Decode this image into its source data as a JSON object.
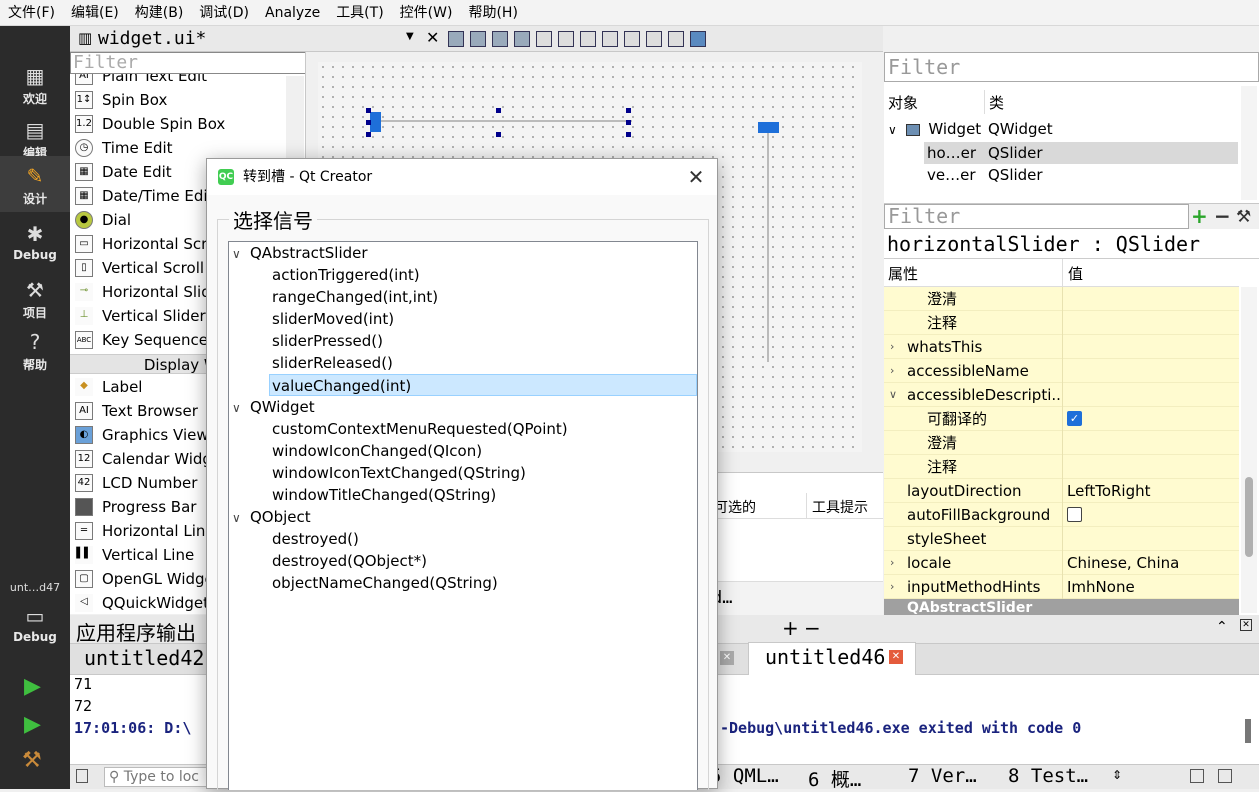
{
  "menubar": {
    "items": [
      "文件(F)",
      "编辑(E)",
      "构建(B)",
      "调试(D)",
      "Analyze",
      "工具(T)",
      "控件(W)",
      "帮助(H)"
    ]
  },
  "modes": [
    {
      "label": "欢迎",
      "icon": "grid-icon"
    },
    {
      "label": "编辑",
      "icon": "document-icon"
    },
    {
      "label": "设计",
      "icon": "pencil-icon"
    },
    {
      "label": "Debug",
      "icon": "bug-icon"
    },
    {
      "label": "项目",
      "icon": "wrench-icon"
    },
    {
      "label": "帮助",
      "icon": "help-icon"
    }
  ],
  "kit": {
    "label": "unt…d47",
    "mode": "Debug"
  },
  "editor": {
    "title": "widget.ui*"
  },
  "widgetbox": {
    "filter_placeholder": "Filter",
    "items_top": [
      "Plain Text Edit",
      "Spin Box",
      "Double Spin Box",
      "Time Edit",
      "Date Edit",
      "Date/Time Edit",
      "Dial",
      "Horizontal Scro",
      "Vertical Scroll",
      "Horizontal Slid",
      "Vertical Slider",
      "Key Sequence"
    ],
    "category": "Display Wid",
    "items_display": [
      "Label",
      "Text Browser",
      "Graphics View",
      "Calendar Widg",
      "LCD Number",
      "Progress Bar",
      "Horizontal Line",
      "Vertical Line",
      "OpenGL Widge",
      "QQuickWidget"
    ]
  },
  "lowerstrip": {
    "col_checkable": "可选的",
    "col_tooltip": "工具提示",
    "trunc": "d…"
  },
  "object_inspector": {
    "filter_placeholder": "Filter",
    "col_object": "对象",
    "col_class": "类",
    "rows": [
      {
        "name": "Widget",
        "cls": "QWidget"
      },
      {
        "name": "ho…er",
        "cls": "QSlider"
      },
      {
        "name": "ve…er",
        "cls": "QSlider"
      }
    ]
  },
  "property_editor": {
    "filter_placeholder": "Filter",
    "title": "horizontalSlider : QSlider",
    "col_prop": "属性",
    "col_value": "值",
    "rows": [
      {
        "name": "澄清",
        "value": ""
      },
      {
        "name": "注释",
        "value": ""
      },
      {
        "name": "whatsThis",
        "value": ""
      },
      {
        "name": "accessibleName",
        "value": ""
      },
      {
        "name": "accessibleDescripti...",
        "value": ""
      },
      {
        "name": "可翻译的",
        "value": ""
      },
      {
        "name": "澄清",
        "value": ""
      },
      {
        "name": "注释",
        "value": ""
      },
      {
        "name": "layoutDirection",
        "value": "LeftToRight"
      },
      {
        "name": "autoFillBackground",
        "value": ""
      },
      {
        "name": "styleSheet",
        "value": ""
      },
      {
        "name": "locale",
        "value": "Chinese, China"
      },
      {
        "name": "inputMethodHints",
        "value": "ImhNone"
      }
    ],
    "section": "QAbstractSlider"
  },
  "output": {
    "header_title": "应用程序输出",
    "tab1": "untitled42",
    "tab2": "untitled46",
    "lines": [
      "71",
      "72"
    ],
    "exit_prefix": "17:01:06: D:\\",
    "exit_suffix": "-Debug\\untitled46.exe exited with code 0"
  },
  "statusbar": {
    "locator_placeholder": "Type to loc",
    "tabs": [
      "5 QML…",
      "6 概…",
      "7 Ver…",
      "8 Test…"
    ]
  },
  "dialog": {
    "icon_text": "QC",
    "title": "转到槽 - Qt Creator",
    "group_title": "选择信号",
    "tree": [
      {
        "kind": "class",
        "label": "QAbstractSlider"
      },
      {
        "kind": "signal",
        "label": "actionTriggered(int)"
      },
      {
        "kind": "signal",
        "label": "rangeChanged(int,int)"
      },
      {
        "kind": "signal",
        "label": "sliderMoved(int)"
      },
      {
        "kind": "signal",
        "label": "sliderPressed()"
      },
      {
        "kind": "signal",
        "label": "sliderReleased()"
      },
      {
        "kind": "signal",
        "label": "valueChanged(int)",
        "selected": true
      },
      {
        "kind": "class",
        "label": "QWidget"
      },
      {
        "kind": "signal",
        "label": "customContextMenuRequested(QPoint)"
      },
      {
        "kind": "signal",
        "label": "windowIconChanged(QIcon)"
      },
      {
        "kind": "signal",
        "label": "windowIconTextChanged(QString)"
      },
      {
        "kind": "signal",
        "label": "windowTitleChanged(QString)"
      },
      {
        "kind": "class",
        "label": "QObject"
      },
      {
        "kind": "signal",
        "label": "destroyed()"
      },
      {
        "kind": "signal",
        "label": "destroyed(QObject*)"
      },
      {
        "kind": "signal",
        "label": "objectNameChanged(QString)"
      }
    ]
  },
  "colors": {
    "accent": "#1e6fd9",
    "selection": "#cce8ff",
    "property_bg": "#fffbd0",
    "modebar": "#2b2b2b",
    "output_blue": "#1a237e"
  }
}
